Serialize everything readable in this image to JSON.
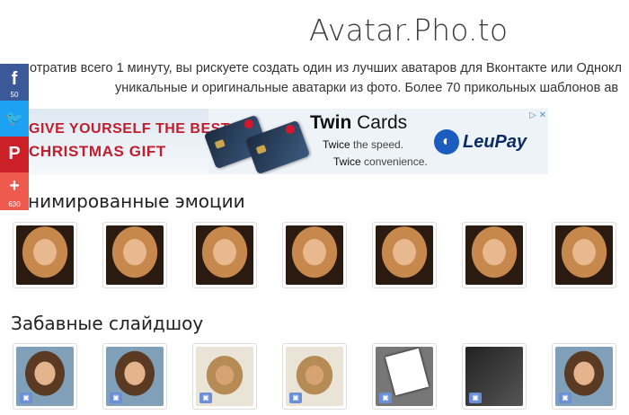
{
  "site": {
    "title": "Avatar.Pho.to"
  },
  "intro": {
    "line1": "отратив всего 1 минуту, вы рискуете создать один из лучших аватаров для Вконтакте или Однокл",
    "line2": "уникальные и оригинальные аватарки из фото. Более 70 прикольных шаблонов ав"
  },
  "share": {
    "facebook": {
      "icon": "f",
      "count": "50"
    },
    "twitter": {
      "icon": "🐦"
    },
    "pinterest": {
      "icon": "P"
    },
    "more": {
      "icon": "+",
      "count": "630"
    }
  },
  "banner": {
    "headline1": "GIVE YOURSELF THE BEST",
    "headline2": "CHRISTMAS GIFT",
    "twin_bold": "Twin",
    "twin_rest": " Cards",
    "tagline1_bold": "Twice",
    "tagline1_rest": " the speed.",
    "tagline2_bold": "Twice",
    "tagline2_rest": " convenience.",
    "brand": "LeuPay",
    "ad_controls": "▷ ✕"
  },
  "sections": [
    {
      "title": "нимированные эмоции"
    },
    {
      "title": "Забавные слайдшоу"
    }
  ]
}
